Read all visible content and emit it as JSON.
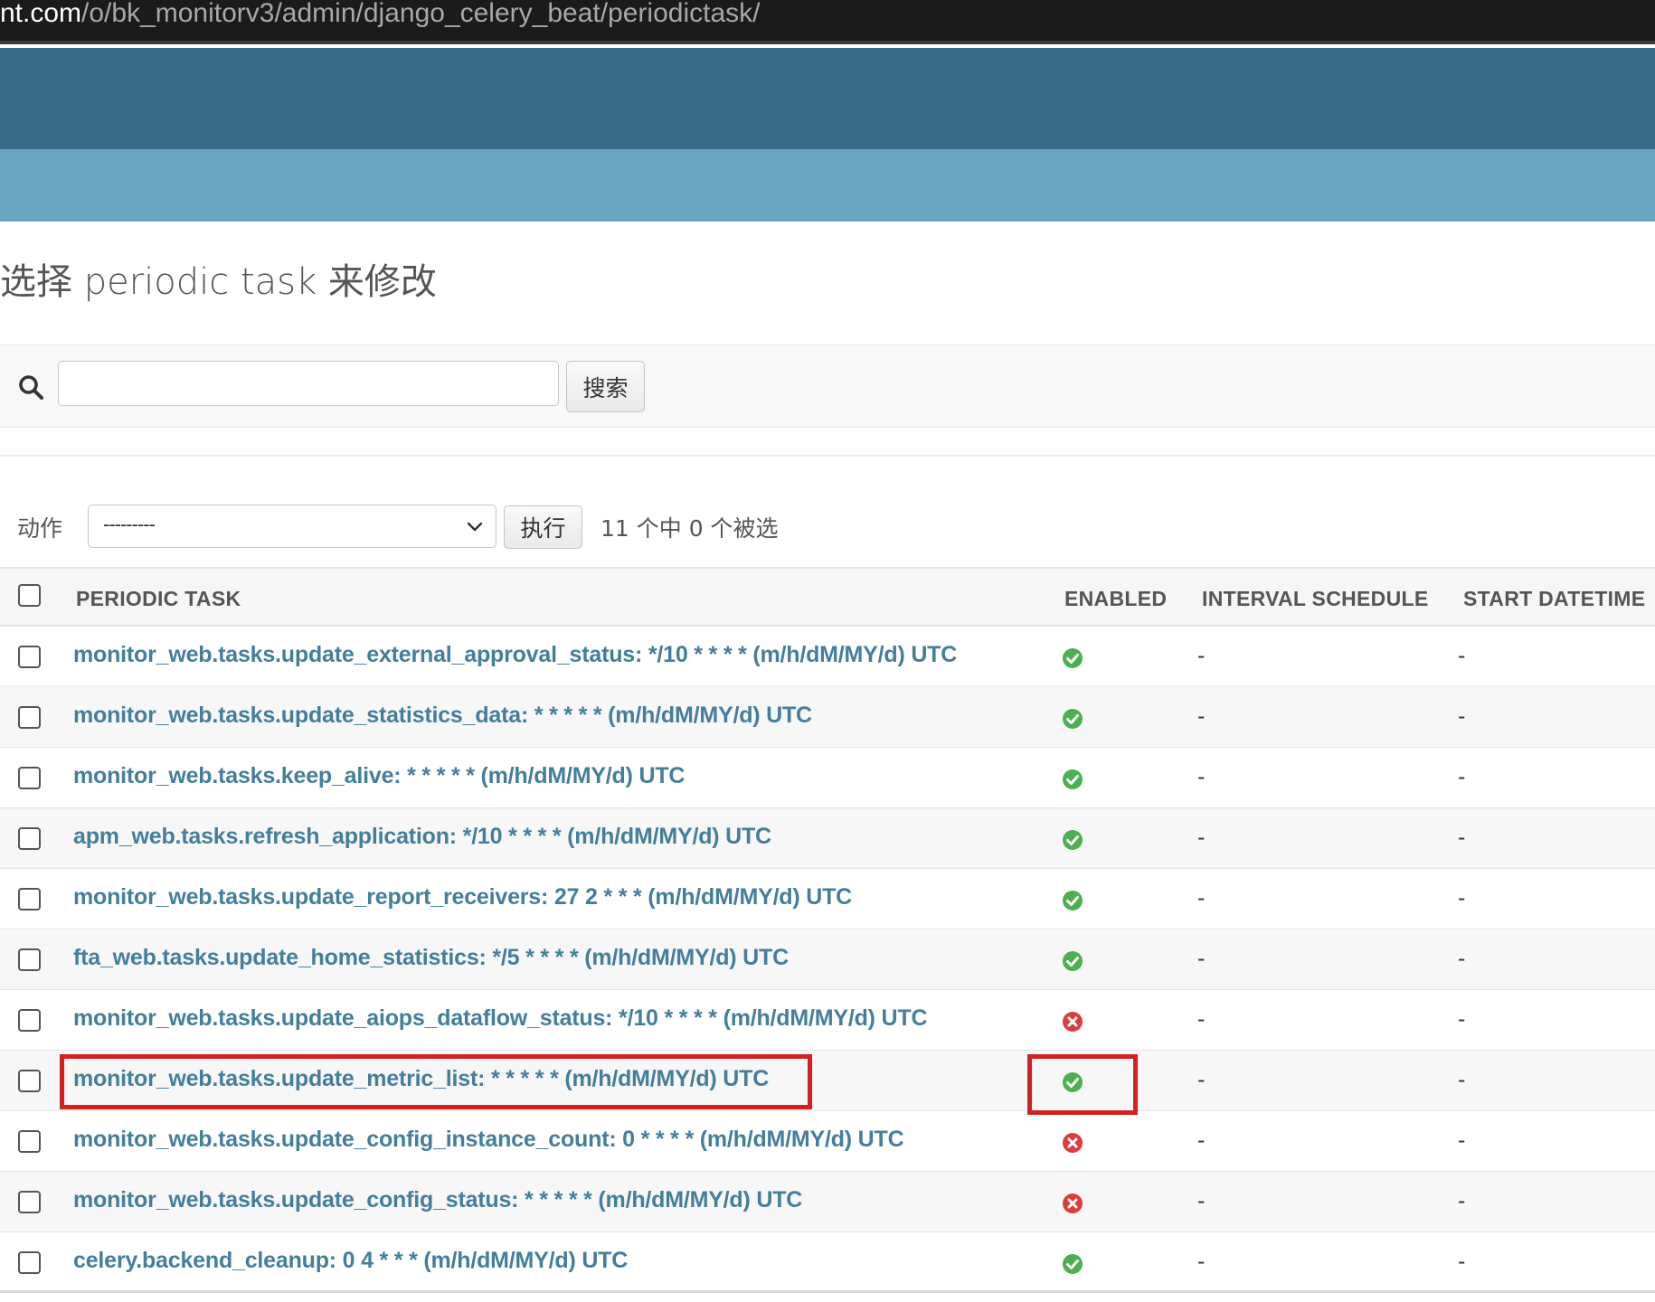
{
  "browser": {
    "url_host": "nt.com",
    "url_path": "/o/bk_monitorv3/admin/django_celery_beat/periodictask/"
  },
  "page": {
    "title": "选择 periodic task 来修改"
  },
  "search": {
    "value": "",
    "placeholder": "",
    "button_label": "搜索"
  },
  "actions": {
    "label": "动作",
    "selected": "---------",
    "run_label": "执行",
    "counter": "11 个中 0 个被选"
  },
  "table": {
    "columns": [
      "PERIODIC TASK",
      "ENABLED",
      "INTERVAL SCHEDULE",
      "START DATETIME"
    ],
    "rows": [
      {
        "task": "monitor_web.tasks.update_external_approval_status: */10 * * * * (m/h/dM/MY/d) UTC",
        "enabled": true,
        "interval": "-",
        "start": "-"
      },
      {
        "task": "monitor_web.tasks.update_statistics_data: * * * * * (m/h/dM/MY/d) UTC",
        "enabled": true,
        "interval": "-",
        "start": "-"
      },
      {
        "task": "monitor_web.tasks.keep_alive: * * * * * (m/h/dM/MY/d) UTC",
        "enabled": true,
        "interval": "-",
        "start": "-"
      },
      {
        "task": "apm_web.tasks.refresh_application: */10 * * * * (m/h/dM/MY/d) UTC",
        "enabled": true,
        "interval": "-",
        "start": "-"
      },
      {
        "task": "monitor_web.tasks.update_report_receivers: 27 2 * * * (m/h/dM/MY/d) UTC",
        "enabled": true,
        "interval": "-",
        "start": "-"
      },
      {
        "task": "fta_web.tasks.update_home_statistics: */5 * * * * (m/h/dM/MY/d) UTC",
        "enabled": true,
        "interval": "-",
        "start": "-"
      },
      {
        "task": "monitor_web.tasks.update_aiops_dataflow_status: */10 * * * * (m/h/dM/MY/d) UTC",
        "enabled": false,
        "interval": "-",
        "start": "-"
      },
      {
        "task": "monitor_web.tasks.update_metric_list: * * * * * (m/h/dM/MY/d) UTC",
        "enabled": true,
        "interval": "-",
        "start": "-",
        "highlighted": true
      },
      {
        "task": "monitor_web.tasks.update_config_instance_count: 0 * * * * (m/h/dM/MY/d) UTC",
        "enabled": false,
        "interval": "-",
        "start": "-"
      },
      {
        "task": "monitor_web.tasks.update_config_status: * * * * * (m/h/dM/MY/d) UTC",
        "enabled": false,
        "interval": "-",
        "start": "-"
      },
      {
        "task": "celery.backend_cleanup: 0 4 * * * (m/h/dM/MY/d) UTC",
        "enabled": true,
        "interval": "-",
        "start": "-"
      }
    ]
  },
  "icons": {
    "enabled_true": "check-circle-icon",
    "enabled_false": "x-circle-icon",
    "search": "search-icon",
    "dropdown": "chevron-down-icon"
  },
  "colors": {
    "header_dark": "#376b85",
    "header_light": "#6aa5c2",
    "link": "#447e9b",
    "enabled_true": "#4caf50",
    "enabled_false": "#dd3d3d",
    "highlight": "#d42020"
  }
}
